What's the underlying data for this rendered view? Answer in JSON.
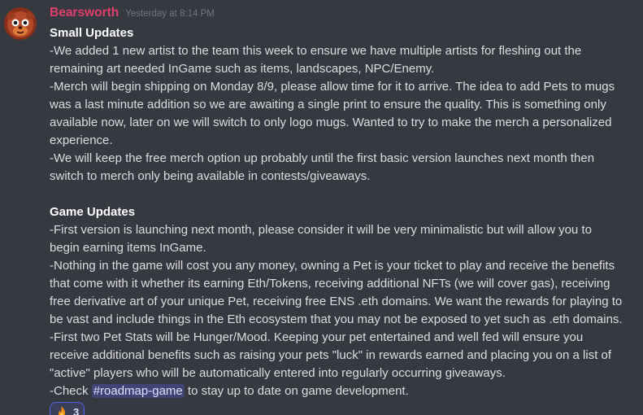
{
  "message": {
    "username": "Bearsworth",
    "timestamp": "Yesterday at 8:14 PM",
    "lines": [
      "Small Updates",
      "-We added 1 new artist to the team this week to ensure we have multiple artists for fleshing out the",
      "remaining art needed InGame such as items, landscapes, NPC/Enemy.",
      "-Merch will begin shipping on Monday 8/9, please allow time for it to arrive. The idea to add Pets to mugs",
      "was a last minute addition so we are awaiting a single print to ensure the quality. This is something only",
      "available now, later on we will switch to only logo mugs. Wanted to try to make the merch a personalized",
      "experience.",
      "-We will keep the free merch option up probably until the first basic version launches next month then",
      "switch to merch only being available in contests/giveaways.",
      "Game Updates",
      "-First version is launching next month, please consider it will be very minimalistic but will allow you to",
      "begin earning items InGame.",
      "-Nothing in the game will cost you any money, owning a Pet is your ticket to play and receive the benefits",
      "that come with it whether its earning Eth/Tokens, receiving additional NFTs (we will cover gas), receiving",
      "free derivative art of your unique Pet, receiving free ENS .eth domains. We want the rewards for playing to",
      "be vast and include things in the Eth ecosystem that you may not be exposed to yet such as .eth domains.",
      "-First two Pet Stats will be Hunger/Mood. Keeping your pet entertained and well fed will ensure you",
      "receive additional benefits such as raising your pets \"luck\" in rewards earned and placing you on a list of",
      "\"active\" players who will be automatically entered into regularly occurring giveaways.",
      "-Check ",
      "#roadmap-game",
      " to stay up to date on game development."
    ]
  },
  "reaction": {
    "emoji": "fire",
    "count": "3"
  },
  "colors": {
    "background": "#36393f",
    "username": "#e03e6c",
    "text": "#dcddde",
    "timestamp": "#72767d",
    "mention_bg": "#4b5291",
    "reaction_border": "#5865f2"
  }
}
